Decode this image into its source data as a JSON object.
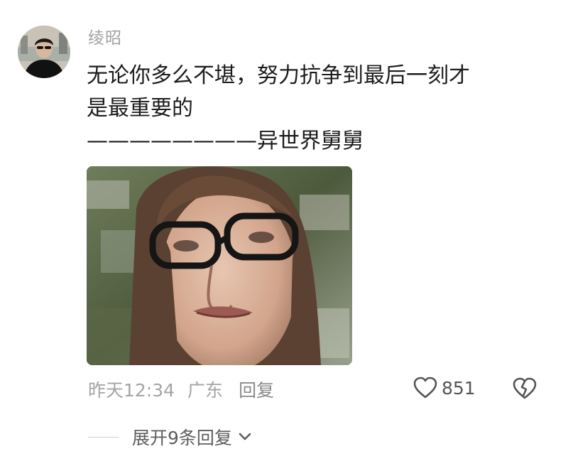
{
  "comment": {
    "username": "绫昭",
    "lines": [
      "无论你多么不堪，努力抗争到最后一刻才",
      "是最重要的",
      "————————异世界舅舅"
    ],
    "timestamp": "昨天12:34",
    "location": "广东",
    "reply_label": "回复",
    "like_count": "851",
    "expand_label": "展开9条回复"
  },
  "icons": {
    "avatar": "avatar-icon",
    "like": "heart-icon",
    "dislike": "broken-heart-icon",
    "expand": "chevron-down-icon"
  },
  "colors": {
    "username": "#a2a2a2",
    "text": "#1c1c1c",
    "meta": "#a4a4a4",
    "icon": "#555555"
  }
}
